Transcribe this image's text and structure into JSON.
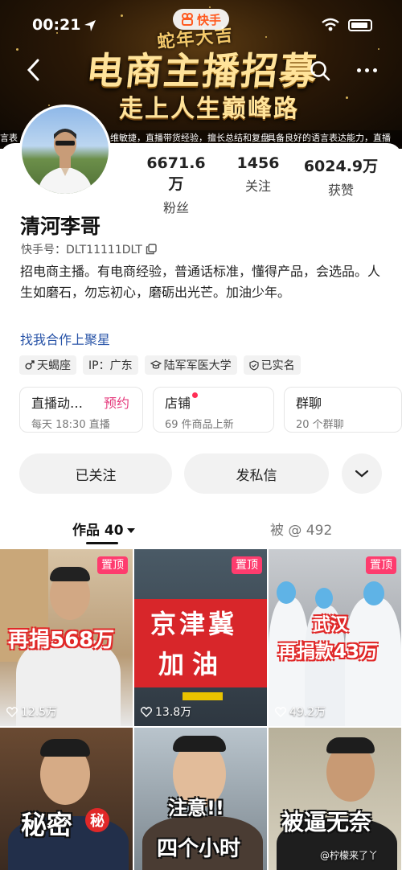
{
  "status": {
    "time": "00:21",
    "app_badge": "快手"
  },
  "banner": {
    "top_text": "蛇年大吉",
    "title": "电商主播招募",
    "subtitle": "走上人生巅峰路",
    "ticker": [
      "言表",
      "维敏捷，直播带货经验，擅长总结和复盘",
      "具备良好的语言表达能力，直播"
    ]
  },
  "profile": {
    "name": "清河李哥",
    "kuaishou_id": "快手号：DLT11111DLT",
    "bio": "招电商主播。有电商经验，普通话标准，懂得产品，会选品。人生如磨石，勿忘初心，磨砺出光芒。加油少年。",
    "link": "找我合作上聚星",
    "stats": [
      {
        "num": "6671.6万",
        "label": "粉丝"
      },
      {
        "num": "1456",
        "label": "关注"
      },
      {
        "num": "6024.9万",
        "label": "获赞"
      }
    ],
    "tags": [
      {
        "icon": "male-icon",
        "text": "天蝎座"
      },
      {
        "icon": "",
        "text": "IP：广东"
      },
      {
        "icon": "school-icon",
        "text": "陆军军医大学"
      },
      {
        "icon": "verified-icon",
        "text": "已实名"
      }
    ]
  },
  "cards": {
    "live": {
      "title": "直播动…",
      "action": "预约",
      "sub": "每天 18:30 直播"
    },
    "shop": {
      "title": "店铺",
      "sub": "69 件商品上新"
    },
    "group": {
      "title": "群聊",
      "sub": "20 个群聊"
    }
  },
  "actions": {
    "follow": "已关注",
    "message": "发私信"
  },
  "tabs": {
    "works": "作品 40",
    "mentioned": "被 @ 492"
  },
  "pin_label": "置顶",
  "videos": [
    {
      "caption": "再捐568万",
      "likes": "12.5万",
      "pinned": true
    },
    {
      "caption": "京津冀",
      "caption2": "加油",
      "likes": "13.8万",
      "pinned": true
    },
    {
      "caption": "武汉",
      "caption2": "再捐款43万",
      "likes": "49.2万",
      "pinned": true
    },
    {
      "caption": "秘密",
      "badge": "秘"
    },
    {
      "caption": "注意!!",
      "caption2": "四个小时"
    },
    {
      "caption": "被逼无奈"
    }
  ],
  "watermark": "@柠檬来了丫"
}
